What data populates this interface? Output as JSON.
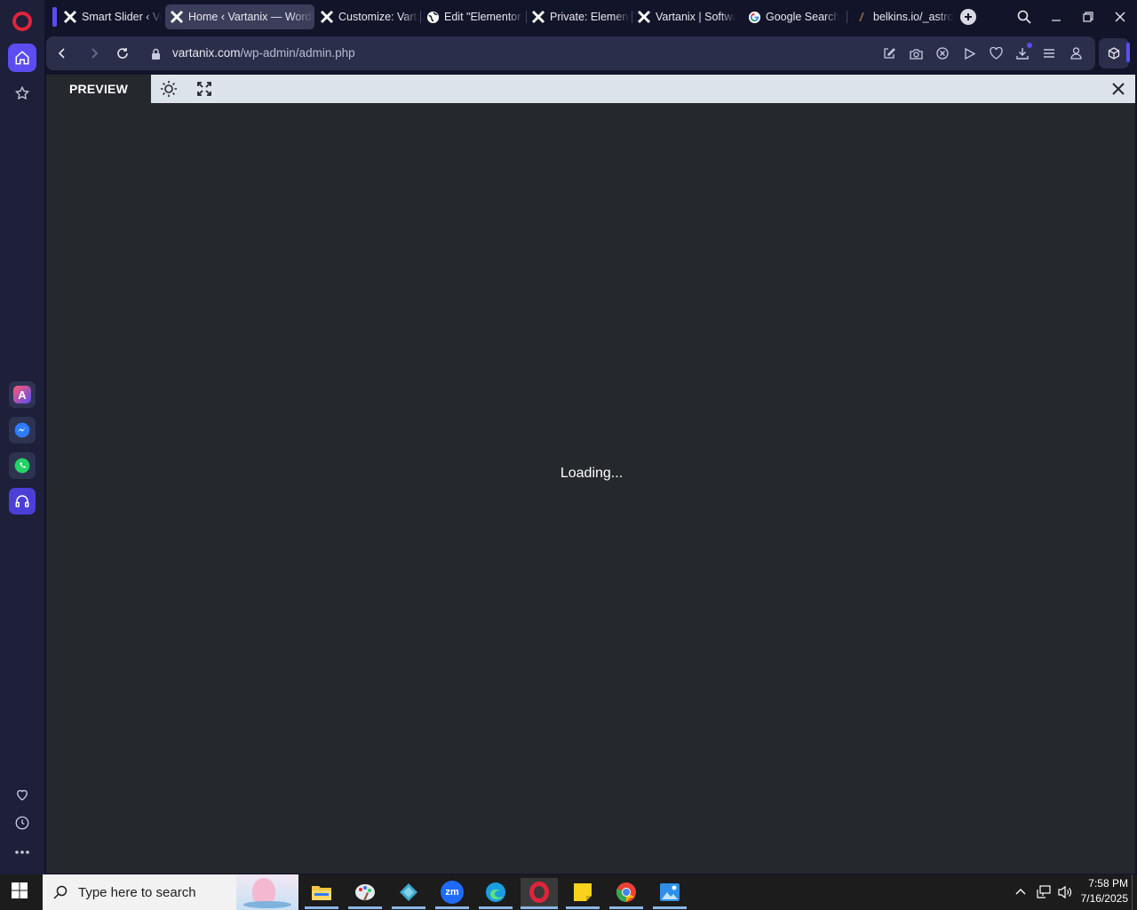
{
  "browser": {
    "tabs": [
      {
        "label": "Smart Slider ‹ Vartanix",
        "icon": "x-logo-icon",
        "active": false
      },
      {
        "label": "Home ‹ Vartanix — WordPress",
        "icon": "x-logo-icon",
        "active": true
      },
      {
        "label": "Customize: Vartanix",
        "icon": "x-logo-icon",
        "active": false
      },
      {
        "label": "Edit \"Elementor Header\"",
        "icon": "globe-icon",
        "active": false
      },
      {
        "label": "Private: Elementor",
        "icon": "x-logo-icon",
        "active": false
      },
      {
        "label": "Vartanix | Software",
        "icon": "x-logo-icon",
        "active": false
      },
      {
        "label": "Google Search",
        "icon": "google-icon",
        "active": false
      },
      {
        "label": "belkins.io/_astro/",
        "icon": "page-icon",
        "active": false
      }
    ],
    "address": {
      "domain": "vartanix.com",
      "path": "/wp-admin/admin.php"
    }
  },
  "preview": {
    "label": "PREVIEW",
    "loading_text": "Loading..."
  },
  "taskbar": {
    "search_placeholder": "Type here to search",
    "time": "7:58 PM",
    "date": "7/16/2025"
  },
  "colors": {
    "accent": "#5b4df2",
    "opera_red": "#e0243b",
    "content_bg": "#25282c",
    "preview_bar": "#dde3ea"
  }
}
